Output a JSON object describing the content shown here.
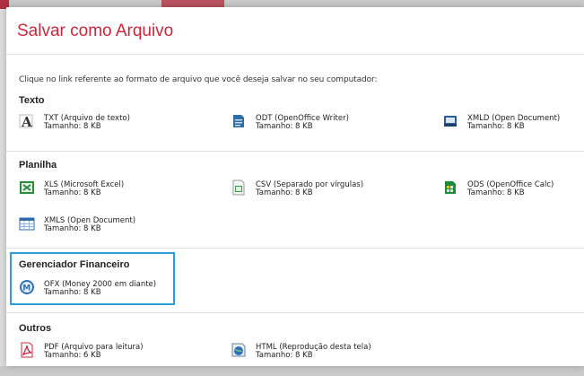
{
  "dialog": {
    "title": "Salvar como Arquivo",
    "instruction": "Clique no link referente ao formato de arquivo que você deseja salvar no seu computador:"
  },
  "sections": {
    "texto": {
      "title": "Texto",
      "items": [
        {
          "name": "TXT (Arquivo de texto)",
          "size": "Tamanho: 8 KB",
          "icon": "txt-icon"
        },
        {
          "name": "ODT (OpenOffice Writer)",
          "size": "Tamanho: 8 KB",
          "icon": "odt-icon"
        },
        {
          "name": "XMLD (Open Document)",
          "size": "Tamanho: 8 KB",
          "icon": "xmld-icon"
        }
      ]
    },
    "planilha": {
      "title": "Planilha",
      "items": [
        {
          "name": "XLS (Microsoft Excel)",
          "size": "Tamanho: 8 KB",
          "icon": "xls-icon"
        },
        {
          "name": "CSV (Separado por vírgulas)",
          "size": "Tamanho: 8 KB",
          "icon": "csv-icon"
        },
        {
          "name": "ODS (OpenOffice Calc)",
          "size": "Tamanho: 8 KB",
          "icon": "ods-icon"
        },
        {
          "name": "XMLS (Open Document)",
          "size": "Tamanho: 8 KB",
          "icon": "xmls-icon"
        }
      ]
    },
    "gerenciador": {
      "title": "Gerenciador Financeiro",
      "items": [
        {
          "name": "OFX (Money 2000 em diante)",
          "size": "Tamanho: 8 KB",
          "icon": "ofx-icon"
        }
      ]
    },
    "outros": {
      "title": "Outros",
      "items": [
        {
          "name": "PDF (Arquivo para leitura)",
          "size": "Tamanho: 6 KB",
          "icon": "pdf-icon"
        },
        {
          "name": "HTML (Reprodução desta tela)",
          "size": "Tamanho: 8 KB",
          "icon": "html-icon"
        }
      ]
    }
  },
  "colors": {
    "title_red": "#c8283c",
    "highlight_blue": "#2b9fd6"
  }
}
